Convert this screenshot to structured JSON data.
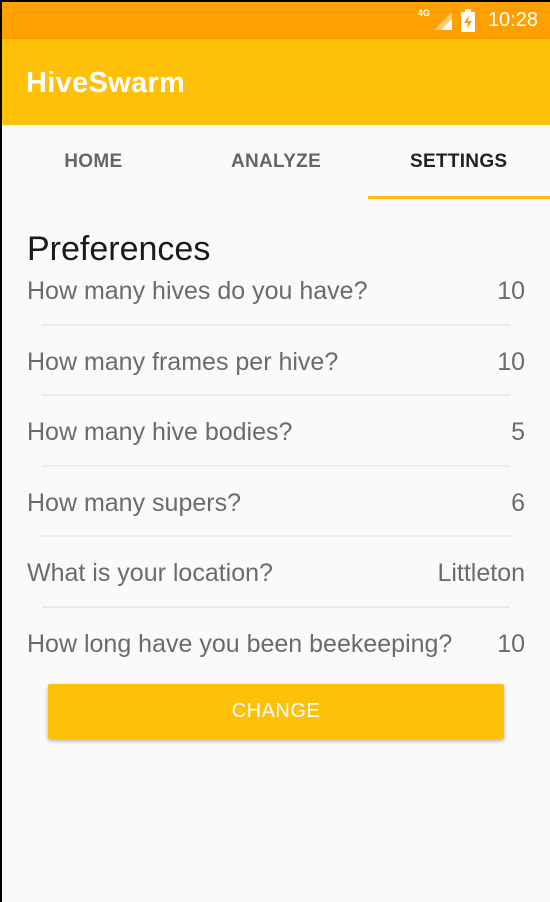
{
  "status_bar": {
    "network": "4G",
    "time": "10:28"
  },
  "app": {
    "title": "HiveSwarm",
    "accent_color": "#ffc107",
    "status_color": "#ffa000"
  },
  "tabs": [
    {
      "label": "HOME",
      "active": false
    },
    {
      "label": "ANALYZE",
      "active": false
    },
    {
      "label": "SETTINGS",
      "active": true
    }
  ],
  "preferences": {
    "title": "Preferences",
    "items": [
      {
        "label": "How many hives do you have?",
        "value": "10"
      },
      {
        "label": "How many frames per hive?",
        "value": "10"
      },
      {
        "label": "How many hive bodies?",
        "value": "5"
      },
      {
        "label": "How many supers?",
        "value": "6"
      },
      {
        "label": "What is your location?",
        "value": "Littleton"
      },
      {
        "label": "How long have you been beekeeping?",
        "value": "10"
      }
    ]
  },
  "change_button": {
    "label": "CHANGE"
  }
}
